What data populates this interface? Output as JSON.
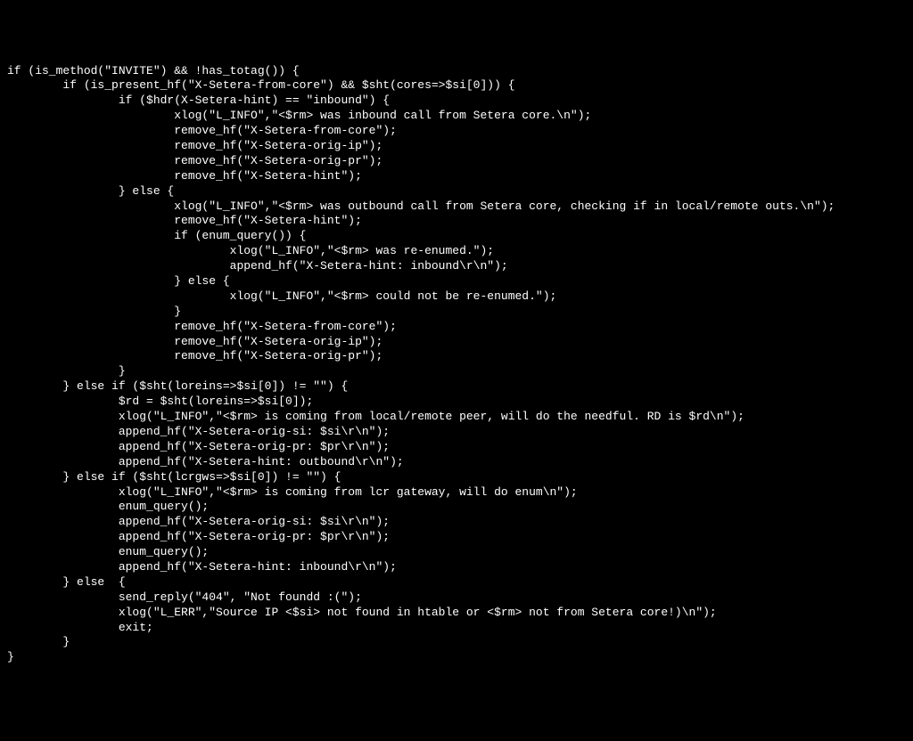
{
  "code": {
    "lines": [
      "if (is_method(\"INVITE\") && !has_totag()) {",
      "        if (is_present_hf(\"X-Setera-from-core\") && $sht(cores=>$si[0])) {",
      "                if ($hdr(X-Setera-hint) == \"inbound\") {",
      "                        xlog(\"L_INFO\",\"<$rm> was inbound call from Setera core.\\n\");",
      "                        remove_hf(\"X-Setera-from-core\");",
      "                        remove_hf(\"X-Setera-orig-ip\");",
      "                        remove_hf(\"X-Setera-orig-pr\");",
      "                        remove_hf(\"X-Setera-hint\");",
      "                } else {",
      "                        xlog(\"L_INFO\",\"<$rm> was outbound call from Setera core, checking if in local/remote outs.\\n\");",
      "                        remove_hf(\"X-Setera-hint\");",
      "                        if (enum_query()) {",
      "                                xlog(\"L_INFO\",\"<$rm> was re-enumed.\");",
      "                                append_hf(\"X-Setera-hint: inbound\\r\\n\");",
      "                        } else {",
      "                                xlog(\"L_INFO\",\"<$rm> could not be re-enumed.\");",
      "                        }",
      "                        remove_hf(\"X-Setera-from-core\");",
      "                        remove_hf(\"X-Setera-orig-ip\");",
      "                        remove_hf(\"X-Setera-orig-pr\");",
      "                }",
      "        } else if ($sht(loreins=>$si[0]) != \"\") {",
      "                $rd = $sht(loreins=>$si[0]);",
      "                xlog(\"L_INFO\",\"<$rm> is coming from local/remote peer, will do the needful. RD is $rd\\n\");",
      "                append_hf(\"X-Setera-orig-si: $si\\r\\n\");",
      "                append_hf(\"X-Setera-orig-pr: $pr\\r\\n\");",
      "                append_hf(\"X-Setera-hint: outbound\\r\\n\");",
      "        } else if ($sht(lcrgws=>$si[0]) != \"\") {",
      "                xlog(\"L_INFO\",\"<$rm> is coming from lcr gateway, will do enum\\n\");",
      "                enum_query();",
      "                append_hf(\"X-Setera-orig-si: $si\\r\\n\");",
      "                append_hf(\"X-Setera-orig-pr: $pr\\r\\n\");",
      "                enum_query();",
      "                append_hf(\"X-Setera-hint: inbound\\r\\n\");",
      "        } else  {",
      "                send_reply(\"404\", \"Not foundd :(\");",
      "                xlog(\"L_ERR\",\"Source IP <$si> not found in htable or <$rm> not from Setera core!)\\n\");",
      "                exit;",
      "        }",
      "}"
    ]
  }
}
